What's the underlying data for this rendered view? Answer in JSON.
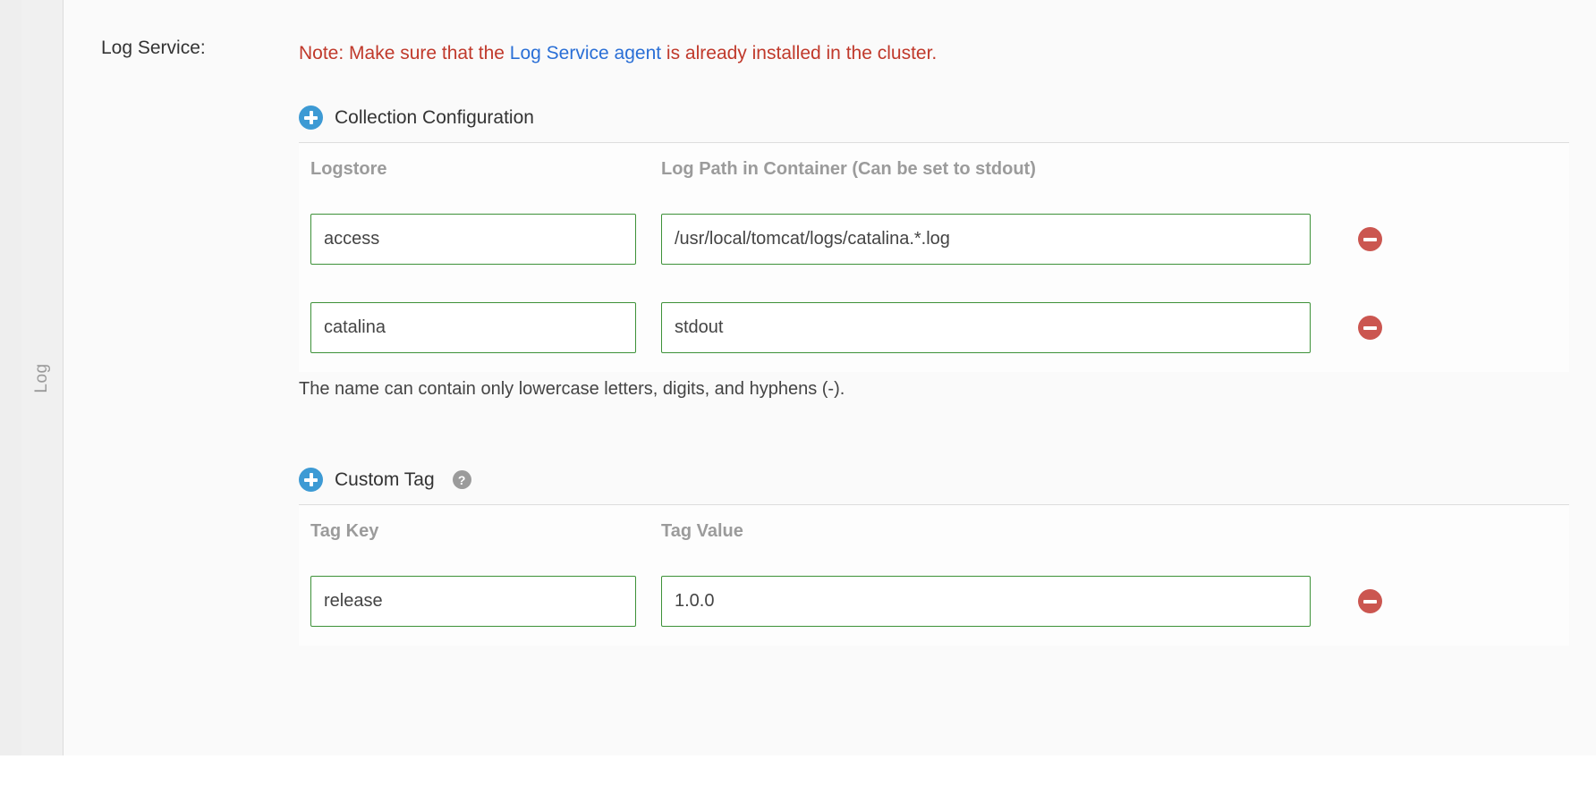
{
  "sidebar": {
    "vertical_tab_label": "Log"
  },
  "form": {
    "section_label": "Log Service:",
    "note": {
      "prefix": "Note: Make sure that the ",
      "link_text": "Log Service agent",
      "suffix": " is already installed in the cluster."
    },
    "helper_text": "The name can contain only lowercase letters, digits, and hyphens (-)."
  },
  "collection_configuration": {
    "title": "Collection Configuration",
    "add_icon": "plus-circle-icon",
    "columns": [
      "Logstore",
      "Log Path in Container (Can be set to stdout)"
    ],
    "rows": [
      {
        "logstore": "access",
        "path": "/usr/local/tomcat/logs/catalina.*.log",
        "remove_icon": "minus-circle-icon"
      },
      {
        "logstore": "catalina",
        "path": "stdout",
        "remove_icon": "minus-circle-icon"
      }
    ]
  },
  "custom_tag": {
    "title": "Custom Tag",
    "add_icon": "plus-circle-icon",
    "help_icon": "question-mark-icon",
    "help_glyph": "?",
    "columns": [
      "Tag Key",
      "Tag Value"
    ],
    "rows": [
      {
        "key": "release",
        "value": "1.0.0",
        "remove_icon": "minus-circle-icon"
      }
    ]
  },
  "colors": {
    "note_red": "#c0392b",
    "link_blue": "#2a6fd6",
    "add_blue": "#3d9ad4",
    "remove_red": "#cb5650",
    "input_border_green": "#3d9138",
    "header_gray": "#9b9b9b"
  }
}
